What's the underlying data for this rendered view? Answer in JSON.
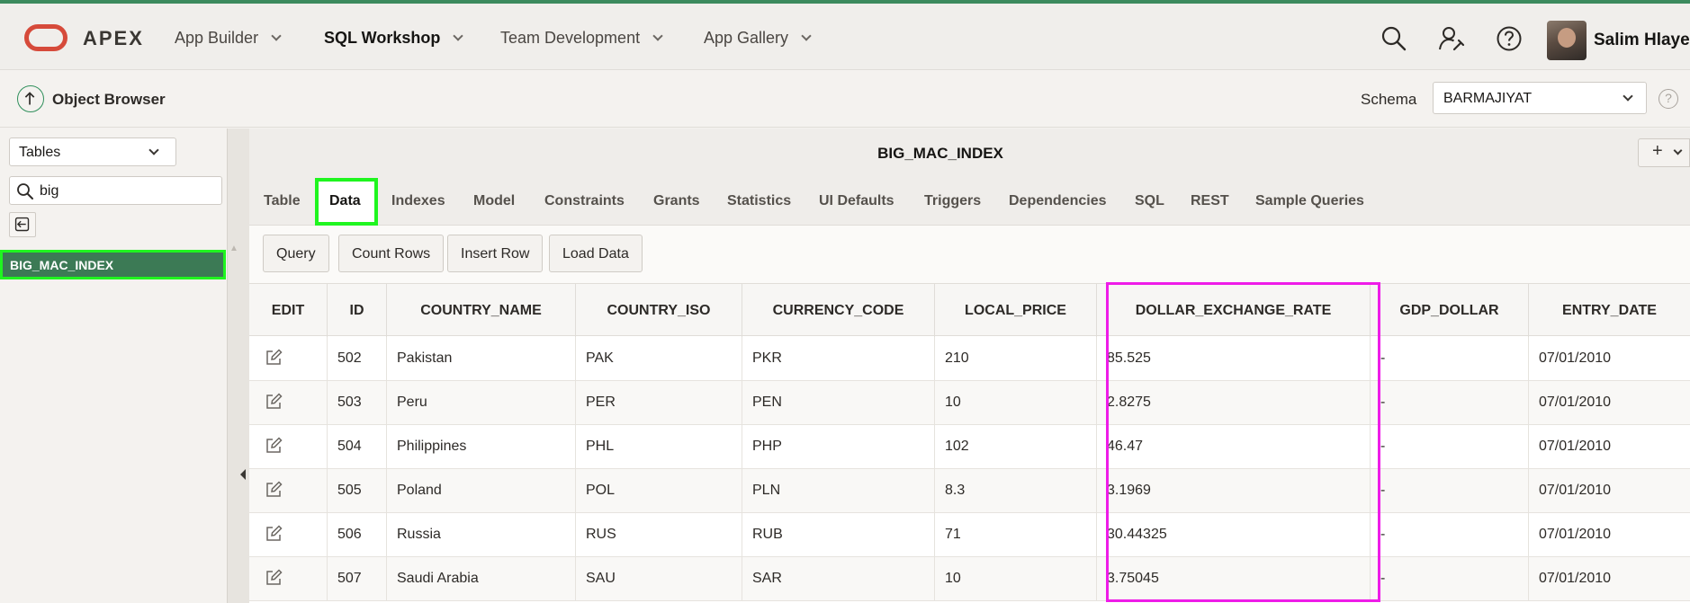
{
  "app": {
    "brand": "APEX",
    "logo_icon": "oracle-logo-icon",
    "nav": [
      {
        "label": "App Builder",
        "active": false
      },
      {
        "label": "SQL Workshop",
        "active": true
      },
      {
        "label": "Team Development",
        "active": false
      },
      {
        "label": "App Gallery",
        "active": false
      }
    ],
    "icons": [
      "search-icon",
      "admin-user-icon",
      "help-icon"
    ],
    "user": {
      "name": "Salim Hlayel"
    },
    "accent_color": "#3c8a5d"
  },
  "subheader": {
    "title": "Object Browser",
    "schema_label": "Schema",
    "schema_value": "BARMAJIYAT",
    "help_glyph": "?"
  },
  "left": {
    "object_type": "Tables",
    "filter_value": "big",
    "items": [
      {
        "label": "BIG_MAC_INDEX",
        "selected": true
      }
    ]
  },
  "main": {
    "title": "BIG_MAC_INDEX",
    "add_label": "+",
    "tabs": [
      "Table",
      "Data",
      "Indexes",
      "Model",
      "Constraints",
      "Grants",
      "Statistics",
      "UI Defaults",
      "Triggers",
      "Dependencies",
      "SQL",
      "REST",
      "Sample Queries"
    ],
    "active_tab": "Data",
    "buttons": [
      "Query",
      "Count Rows",
      "Insert Row",
      "Load Data"
    ]
  },
  "grid": {
    "columns": [
      "EDIT",
      "ID",
      "COUNTRY_NAME",
      "COUNTRY_ISO",
      "CURRENCY_CODE",
      "LOCAL_PRICE",
      "DOLLAR_EXCHANGE_RATE",
      "GDP_DOLLAR",
      "ENTRY_DATE"
    ],
    "highlighted_column": "DOLLAR_EXCHANGE_RATE",
    "rows": [
      {
        "id": "502",
        "country_name": "Pakistan",
        "country_iso": "PAK",
        "currency_code": "PKR",
        "local_price": "210",
        "dollar_exchange_rate": "85.525",
        "gdp_dollar": "-",
        "entry_date": "07/01/2010"
      },
      {
        "id": "503",
        "country_name": "Peru",
        "country_iso": "PER",
        "currency_code": "PEN",
        "local_price": "10",
        "dollar_exchange_rate": "2.8275",
        "gdp_dollar": "-",
        "entry_date": "07/01/2010"
      },
      {
        "id": "504",
        "country_name": "Philippines",
        "country_iso": "PHL",
        "currency_code": "PHP",
        "local_price": "102",
        "dollar_exchange_rate": "46.47",
        "gdp_dollar": "-",
        "entry_date": "07/01/2010"
      },
      {
        "id": "505",
        "country_name": "Poland",
        "country_iso": "POL",
        "currency_code": "PLN",
        "local_price": "8.3",
        "dollar_exchange_rate": "3.1969",
        "gdp_dollar": "-",
        "entry_date": "07/01/2010"
      },
      {
        "id": "506",
        "country_name": "Russia",
        "country_iso": "RUS",
        "currency_code": "RUB",
        "local_price": "71",
        "dollar_exchange_rate": "30.44325",
        "gdp_dollar": "-",
        "entry_date": "07/01/2010"
      },
      {
        "id": "507",
        "country_name": "Saudi Arabia",
        "country_iso": "SAU",
        "currency_code": "SAR",
        "local_price": "10",
        "dollar_exchange_rate": "3.75045",
        "gdp_dollar": "-",
        "entry_date": "07/01/2010"
      }
    ]
  }
}
